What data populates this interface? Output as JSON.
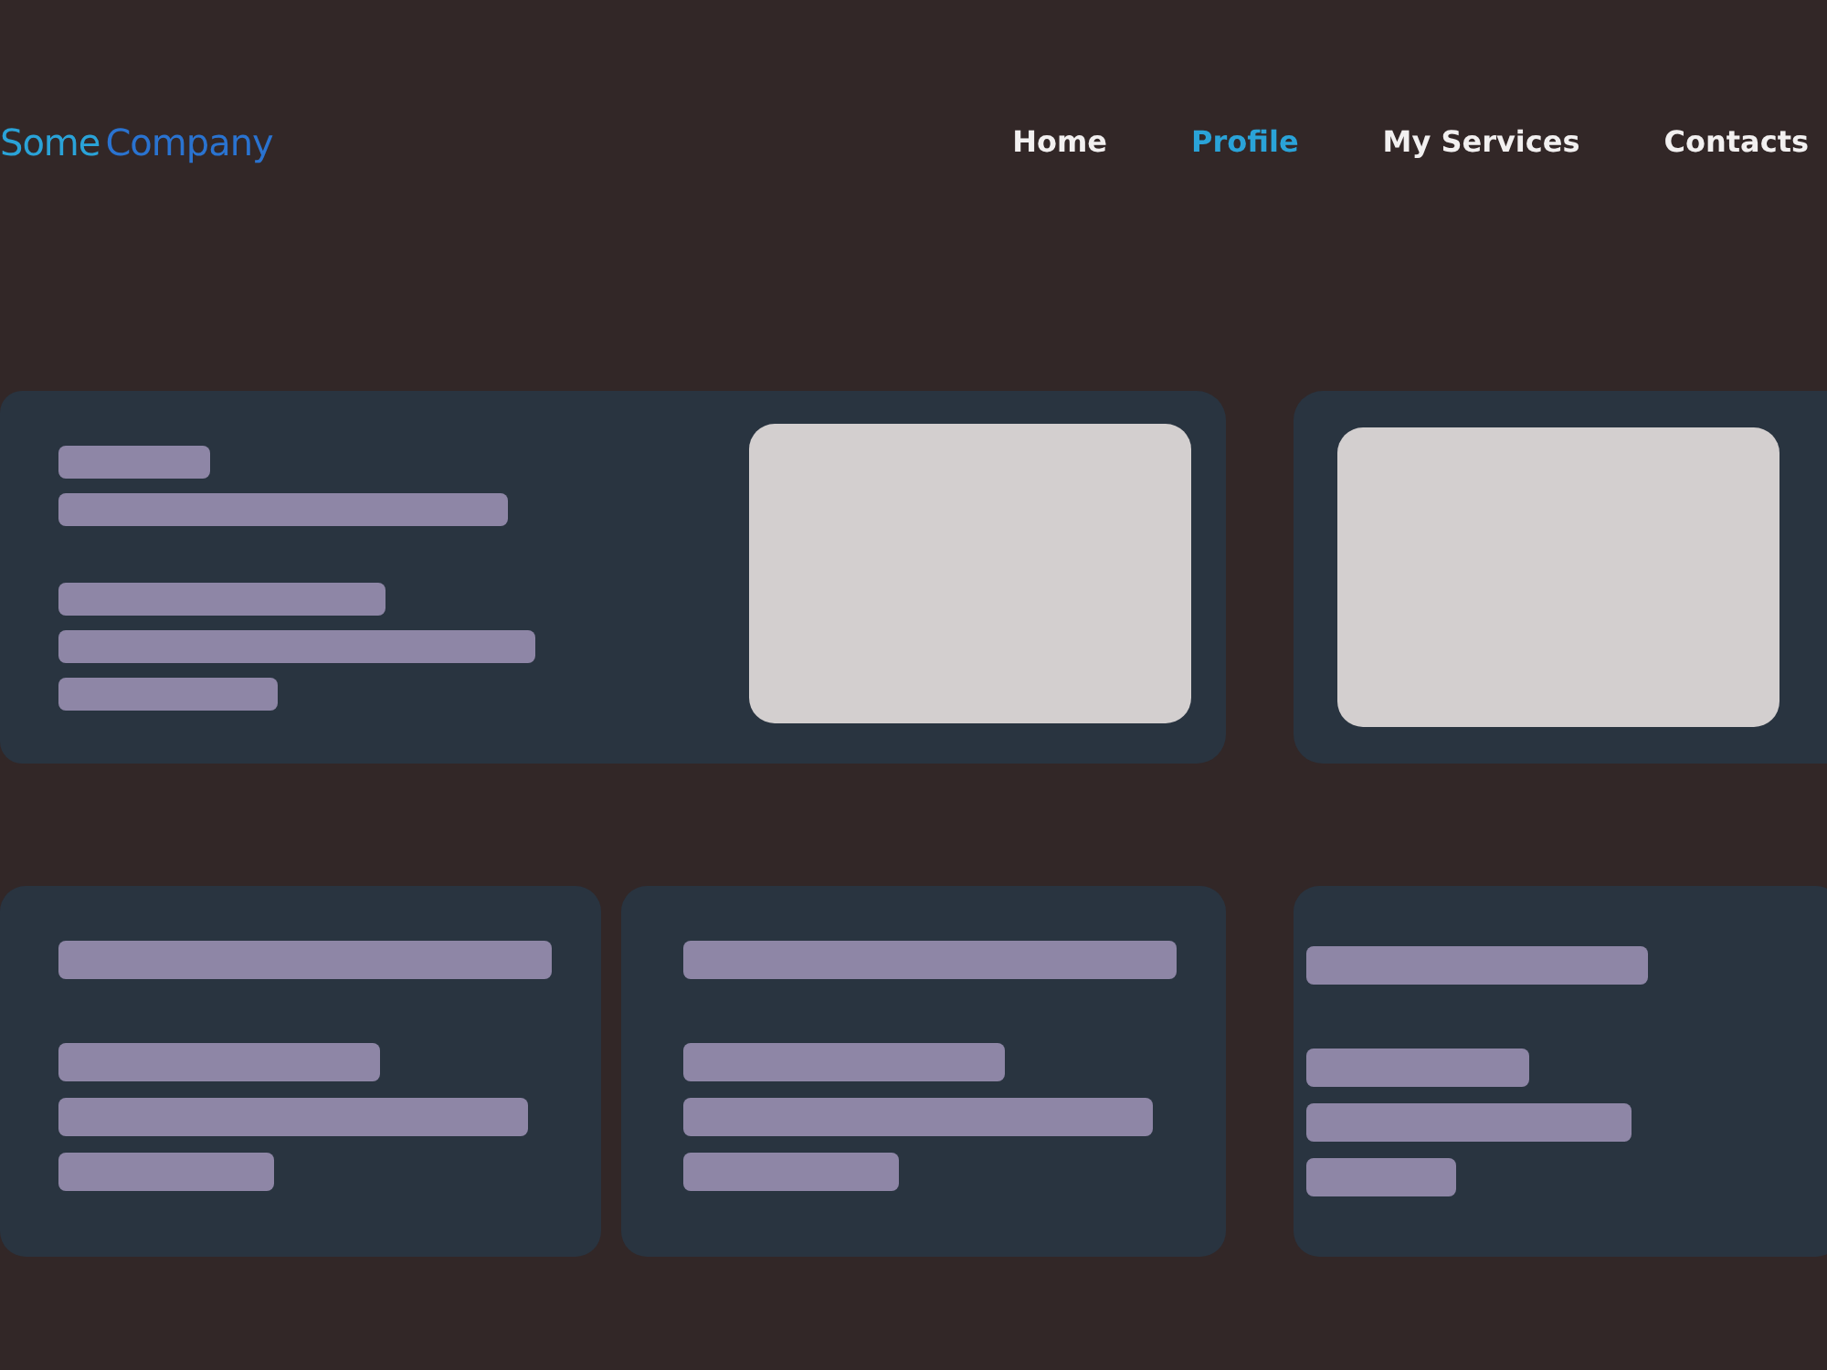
{
  "logo": {
    "first": "Some",
    "second": "Company"
  },
  "nav": [
    {
      "label": "Home",
      "selected": false
    },
    {
      "label": "Profile",
      "selected": true
    },
    {
      "label": "My Services",
      "selected": false
    },
    {
      "label": "Contacts",
      "selected": false
    }
  ],
  "top_cards": [
    {
      "kind": "text-media"
    },
    {
      "kind": "media"
    }
  ],
  "bottom_cards": [
    {
      "kind": "text"
    },
    {
      "kind": "text"
    },
    {
      "kind": "text"
    }
  ]
}
